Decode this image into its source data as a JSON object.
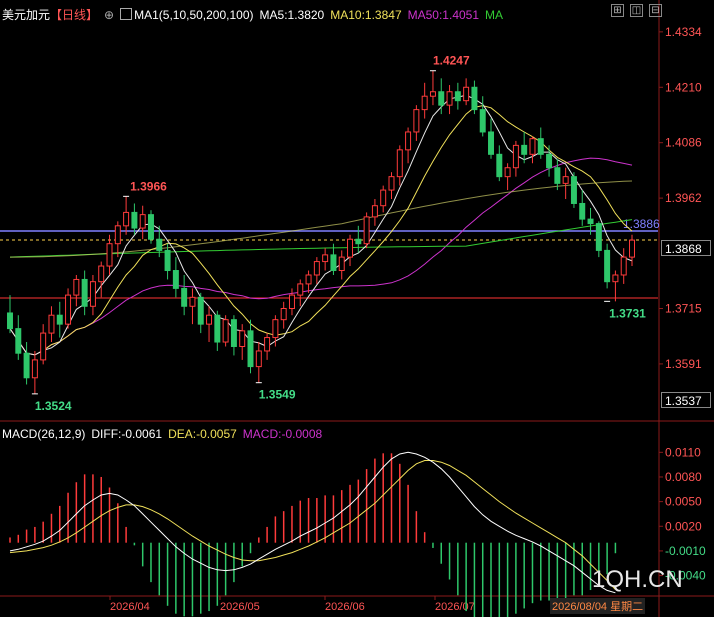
{
  "header": {
    "symbol": "美元加元",
    "period": "【日线】",
    "ma_label": "MA1(5,10,50,200,100)",
    "ma5": "MA5:1.3820",
    "ma10": "MA10:1.3847",
    "ma50": "MA50:1.4051",
    "ma_extra": "MA"
  },
  "window_buttons": [
    "⊞",
    "◫",
    "⊟"
  ],
  "colors": {
    "up": "#ff3b3b",
    "down": "#2ec76a",
    "ma5": "#e8e8e8",
    "ma10": "#f0e05a",
    "ma50": "#cc33cc",
    "ma200": "#33cc33",
    "ma100": "#cccc66",
    "hline_blue": "#8080ff",
    "hline_red": "#ff3333",
    "hline_yellow_dash": "#ffd24d",
    "diff": "#ffffff",
    "dea": "#f0e05a",
    "axis_text": "#ff5555",
    "axis_text_green": "#44dd88"
  },
  "macd_header": {
    "label": "MACD(26,12,9)",
    "diff": "DIFF:-0.0061",
    "dea": "DEA:-0.0057",
    "macd": "MACD:-0.0008"
  },
  "labels": {
    "current_price": "1.3868",
    "blue_line": "1.3886",
    "last_low_axis": "1.3537",
    "date_highlight": "2026/08/04 星期二",
    "watermark": "1QH.CN"
  },
  "chart_data": {
    "type": "candlestick",
    "ylim": [
      1.347,
      1.4365
    ],
    "y_ticks": [
      "1.4334",
      "1.4210",
      "1.4086",
      "1.3962",
      "1.3715",
      "1.3591"
    ],
    "x_ticks": [
      "2026/04",
      "2026/05",
      "2026/06",
      "2026/07"
    ],
    "annotations": [
      {
        "text": "1.3524",
        "value": 1.3524,
        "type": "low"
      },
      {
        "text": "1.3966",
        "value": 1.3966,
        "type": "high"
      },
      {
        "text": "1.3549",
        "value": 1.3549,
        "type": "low"
      },
      {
        "text": "1.4247",
        "value": 1.4247,
        "type": "high"
      },
      {
        "text": "1.3731",
        "value": 1.3731,
        "type": "low"
      }
    ],
    "hlines": [
      {
        "value": 1.3886,
        "color": "blue"
      },
      {
        "value": 1.3868,
        "color": "yellow-dash"
      },
      {
        "value": 1.3729,
        "color": "red"
      }
    ],
    "candles": [
      [
        1.3705,
        1.3745,
        1.366,
        1.367
      ],
      [
        1.367,
        1.37,
        1.36,
        1.3615
      ],
      [
        1.3615,
        1.364,
        1.3545,
        1.356
      ],
      [
        1.356,
        1.362,
        1.3524,
        1.36
      ],
      [
        1.36,
        1.368,
        1.359,
        1.366
      ],
      [
        1.366,
        1.372,
        1.364,
        1.37
      ],
      [
        1.37,
        1.373,
        1.365,
        1.368
      ],
      [
        1.368,
        1.376,
        1.367,
        1.3745
      ],
      [
        1.3745,
        1.379,
        1.372,
        1.378
      ],
      [
        1.378,
        1.38,
        1.37,
        1.372
      ],
      [
        1.372,
        1.379,
        1.37,
        1.3775
      ],
      [
        1.3775,
        1.382,
        1.374,
        1.381
      ],
      [
        1.381,
        1.388,
        1.379,
        1.386
      ],
      [
        1.386,
        1.391,
        1.383,
        1.39
      ],
      [
        1.39,
        1.3966,
        1.388,
        1.393
      ],
      [
        1.393,
        1.395,
        1.388,
        1.3895
      ],
      [
        1.3895,
        1.3945,
        1.387,
        1.3925
      ],
      [
        1.3925,
        1.3935,
        1.386,
        1.387
      ],
      [
        1.387,
        1.39,
        1.383,
        1.3845
      ],
      [
        1.3845,
        1.386,
        1.378,
        1.38
      ],
      [
        1.38,
        1.383,
        1.374,
        1.376
      ],
      [
        1.376,
        1.379,
        1.37,
        1.372
      ],
      [
        1.372,
        1.376,
        1.368,
        1.374
      ],
      [
        1.374,
        1.375,
        1.366,
        1.368
      ],
      [
        1.368,
        1.372,
        1.364,
        1.37
      ],
      [
        1.37,
        1.371,
        1.362,
        1.364
      ],
      [
        1.364,
        1.37,
        1.363,
        1.369
      ],
      [
        1.369,
        1.37,
        1.361,
        1.363
      ],
      [
        1.363,
        1.368,
        1.36,
        1.3665
      ],
      [
        1.3665,
        1.369,
        1.357,
        1.3585
      ],
      [
        1.3585,
        1.364,
        1.3549,
        1.362
      ],
      [
        1.362,
        1.366,
        1.36,
        1.365
      ],
      [
        1.365,
        1.37,
        1.363,
        1.369
      ],
      [
        1.369,
        1.373,
        1.367,
        1.3715
      ],
      [
        1.3715,
        1.376,
        1.37,
        1.3745
      ],
      [
        1.3745,
        1.378,
        1.372,
        1.377
      ],
      [
        1.377,
        1.38,
        1.375,
        1.379
      ],
      [
        1.379,
        1.383,
        1.377,
        1.382
      ],
      [
        1.382,
        1.385,
        1.38,
        1.3835
      ],
      [
        1.3835,
        1.386,
        1.379,
        1.38
      ],
      [
        1.38,
        1.3845,
        1.378,
        1.383
      ],
      [
        1.383,
        1.388,
        1.381,
        1.387
      ],
      [
        1.387,
        1.39,
        1.384,
        1.386
      ],
      [
        1.386,
        1.393,
        1.385,
        1.392
      ],
      [
        1.392,
        1.396,
        1.39,
        1.3945
      ],
      [
        1.3945,
        1.399,
        1.393,
        1.398
      ],
      [
        1.398,
        1.402,
        1.396,
        1.401
      ],
      [
        1.401,
        1.408,
        1.399,
        1.407
      ],
      [
        1.407,
        1.412,
        1.404,
        1.411
      ],
      [
        1.411,
        1.417,
        1.409,
        1.416
      ],
      [
        1.416,
        1.422,
        1.414,
        1.419
      ],
      [
        1.419,
        1.4247,
        1.417,
        1.42
      ],
      [
        1.42,
        1.423,
        1.415,
        1.417
      ],
      [
        1.417,
        1.4215,
        1.415,
        1.42
      ],
      [
        1.42,
        1.422,
        1.416,
        1.418
      ],
      [
        1.418,
        1.423,
        1.417,
        1.421
      ],
      [
        1.421,
        1.4225,
        1.415,
        1.416
      ],
      [
        1.416,
        1.419,
        1.41,
        1.411
      ],
      [
        1.411,
        1.414,
        1.405,
        1.406
      ],
      [
        1.406,
        1.408,
        1.4,
        1.401
      ],
      [
        1.401,
        1.404,
        1.398,
        1.403
      ],
      [
        1.403,
        1.409,
        1.401,
        1.408
      ],
      [
        1.408,
        1.411,
        1.404,
        1.406
      ],
      [
        1.406,
        1.41,
        1.404,
        1.4095
      ],
      [
        1.4095,
        1.412,
        1.405,
        1.406
      ],
      [
        1.406,
        1.408,
        1.401,
        1.403
      ],
      [
        1.403,
        1.405,
        1.398,
        1.3995
      ],
      [
        1.3995,
        1.403,
        1.396,
        1.401
      ],
      [
        1.401,
        1.402,
        1.394,
        1.395
      ],
      [
        1.395,
        1.398,
        1.39,
        1.3915
      ],
      [
        1.3915,
        1.394,
        1.388,
        1.3905
      ],
      [
        1.3905,
        1.391,
        1.383,
        1.3845
      ],
      [
        1.3845,
        1.386,
        1.376,
        1.3775
      ],
      [
        1.3775,
        1.38,
        1.3731,
        1.379
      ],
      [
        1.379,
        1.385,
        1.377,
        1.383
      ],
      [
        1.383,
        1.388,
        1.381,
        1.3868
      ]
    ]
  },
  "macd_data": {
    "ylim": [
      -0.006,
      0.0125
    ],
    "y_ticks": [
      "0.0110",
      "0.0080",
      "0.0050",
      "0.0020",
      "-0.0010",
      "-0.0040"
    ],
    "diff": [
      -0.001,
      -0.0008,
      -0.0005,
      -0.0002,
      0.0002,
      0.0008,
      0.0015,
      0.0025,
      0.0035,
      0.0045,
      0.0052,
      0.0058,
      0.006,
      0.0058,
      0.0052,
      0.0045,
      0.0035,
      0.0025,
      0.0015,
      0.0005,
      -0.0005,
      -0.0013,
      -0.002,
      -0.0025,
      -0.003,
      -0.0033,
      -0.0034,
      -0.0033,
      -0.003,
      -0.0026,
      -0.002,
      -0.0014,
      -0.0008,
      -0.0003,
      0.0002,
      0.0008,
      0.0013,
      0.0018,
      0.0024,
      0.003,
      0.0038,
      0.0046,
      0.0056,
      0.0068,
      0.008,
      0.0092,
      0.0102,
      0.0108,
      0.011,
      0.0108,
      0.0104,
      0.0098,
      0.009,
      0.008,
      0.0068,
      0.0056,
      0.0044,
      0.0034,
      0.0026,
      0.002,
      0.0014,
      0.0009,
      0.0005,
      0.0001,
      -0.0004,
      -0.001,
      -0.0016,
      -0.0022,
      -0.0028,
      -0.0036,
      -0.0044,
      -0.0052,
      -0.0058,
      -0.0061
    ],
    "dea": [
      -0.0012,
      -0.0011,
      -0.001,
      -0.0008,
      -0.0006,
      -0.0003,
      0.0001,
      0.0006,
      0.0012,
      0.0019,
      0.0026,
      0.0033,
      0.0039,
      0.0043,
      0.0046,
      0.0046,
      0.0044,
      0.004,
      0.0035,
      0.0029,
      0.0022,
      0.0015,
      0.0008,
      0.0002,
      -0.0004,
      -0.0009,
      -0.0014,
      -0.0018,
      -0.0021,
      -0.0022,
      -0.0022,
      -0.002,
      -0.0018,
      -0.0015,
      -0.0012,
      -0.0008,
      -0.0004,
      0.0001,
      0.0006,
      0.0012,
      0.0018,
      0.0024,
      0.0032,
      0.004,
      0.0048,
      0.0058,
      0.0068,
      0.0078,
      0.0088,
      0.0096,
      0.01,
      0.01,
      0.0098,
      0.0094,
      0.0088,
      0.0082,
      0.0074,
      0.0066,
      0.0058,
      0.005,
      0.0043,
      0.0036,
      0.003,
      0.0024,
      0.0018,
      0.0012,
      0.0006,
      0.0,
      -0.0008,
      -0.0016,
      -0.0026,
      -0.0036,
      -0.0046,
      -0.0057
    ]
  }
}
